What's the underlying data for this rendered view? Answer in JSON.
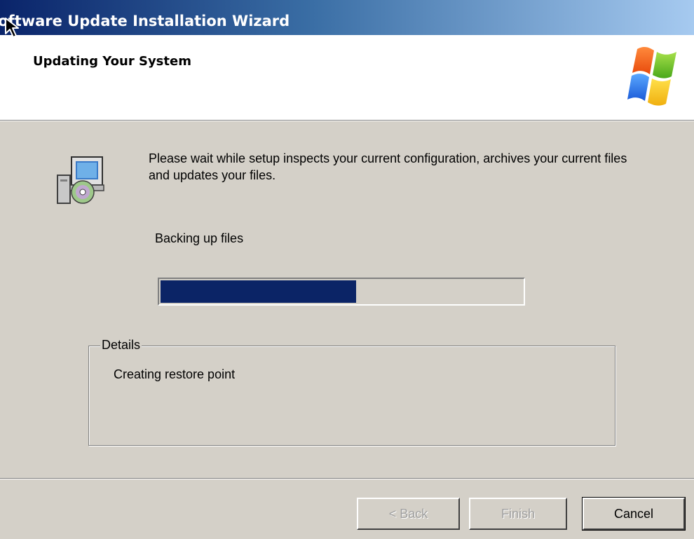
{
  "window": {
    "title": "Software Update Installation Wizard",
    "colors": {
      "title_start": "#0a246a",
      "title_end": "#a6caf0",
      "face": "#d4d0c8",
      "progress": "#0b2466"
    }
  },
  "header": {
    "title": "Updating Your System",
    "logo_icon": "windows-flag-icon"
  },
  "main": {
    "icon": "setup-computer-cd-icon",
    "intro": "Please wait while setup inspects your current configuration, archives your current files and updates your files.",
    "status": "Backing up files",
    "progress_fraction": 0.54
  },
  "details": {
    "legend": "Details",
    "text": "Creating restore point"
  },
  "buttons": {
    "back": "< Back",
    "finish": "Finish",
    "cancel": "Cancel"
  }
}
